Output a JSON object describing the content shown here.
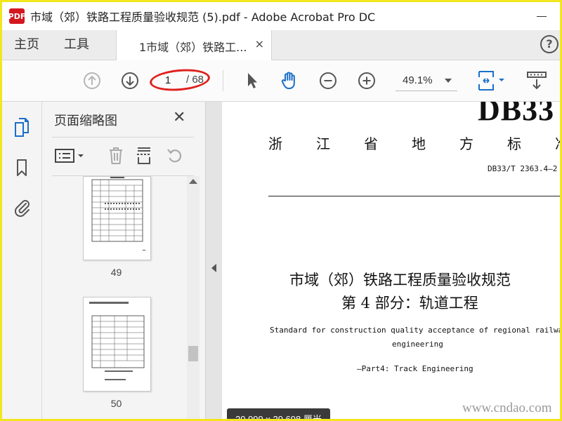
{
  "window": {
    "logo_text": "PDF",
    "title": "市域（郊）铁路工程质量验收规范 (5).pdf - Adobe Acrobat Pro DC"
  },
  "tabs": {
    "home": "主页",
    "tools": "工具",
    "document": "1市域（郊）铁路工...",
    "close": "×",
    "help": "?"
  },
  "toolbar": {
    "page_current": "1",
    "page_total": "/ 68",
    "zoom": "49.1%"
  },
  "thumbnail_panel": {
    "title": "页面缩略图",
    "close": "✕",
    "pages": [
      "49",
      "50"
    ]
  },
  "document": {
    "code_big": "DB33",
    "local_standard": "浙江省地方标准",
    "standard_code": "DB33/T 2363.4—2",
    "title_line1": "市域（郊）铁路工程质量验收规范",
    "title_line2": "第 4 部分：轨道工程",
    "english_line1": "Standard for construction quality acceptance of regional railway",
    "english_line2": "engineering",
    "english_line3": "—Part4: Track Engineering",
    "page_size": "20.999 x 29.698 厘米",
    "watermark": "www.cndao.com"
  },
  "colors": {
    "annotation": "#e0201c",
    "hand_tool": "#1a6fc9",
    "frame": "#f2e61c"
  }
}
